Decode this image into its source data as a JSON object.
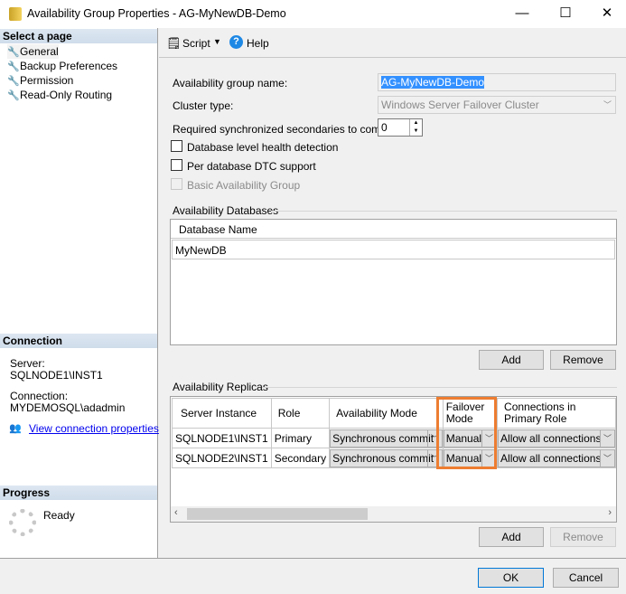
{
  "window": {
    "title": "Availability Group Properties - AG-MyNewDB-Demo",
    "minimize": "—",
    "maximize": "☐",
    "close": "✕"
  },
  "sidebar": {
    "select_header": "Select a page",
    "items": [
      {
        "label": "General"
      },
      {
        "label": "Backup Preferences"
      },
      {
        "label": "Permission"
      },
      {
        "label": "Read-Only Routing"
      }
    ],
    "connection_header": "Connection",
    "server_label": "Server:",
    "server_value": "SQLNODE1\\INST1",
    "connection_label": "Connection:",
    "connection_value": "MYDEMOSQL\\adadmin",
    "view_link": "View connection properties",
    "progress_header": "Progress",
    "progress_status": "Ready"
  },
  "toolbar": {
    "script": "Script",
    "help": "Help"
  },
  "form": {
    "ag_name_label": "Availability group name:",
    "ag_name_value": "AG-MyNewDB-Demo",
    "cluster_label": "Cluster type:",
    "cluster_value": "Windows Server Failover Cluster",
    "req_label": "Required synchronized secondaries to commit:",
    "req_value": "0",
    "db_health": "Database level health detection",
    "dtc": "Per database DTC support",
    "basic": "Basic Availability Group"
  },
  "databases": {
    "title": "Availability Databases",
    "header": "Database Name",
    "rows": [
      "MyNewDB"
    ],
    "add": "Add",
    "remove": "Remove"
  },
  "replicas": {
    "title": "Availability Replicas",
    "headers": [
      "Server Instance",
      "Role",
      "Availability Mode",
      "Failover Mode",
      "Connections in Primary Role"
    ],
    "rows": [
      [
        "SQLNODE1\\INST1",
        "Primary",
        "Synchronous commit",
        "Manual",
        "Allow all connections"
      ],
      [
        "SQLNODE2\\INST1",
        "Secondary",
        "Synchronous commit",
        "Manual",
        "Allow all connections"
      ]
    ],
    "add": "Add",
    "remove": "Remove",
    "highlight_color": "#ed7d31"
  },
  "footer": {
    "ok": "OK",
    "cancel": "Cancel"
  }
}
